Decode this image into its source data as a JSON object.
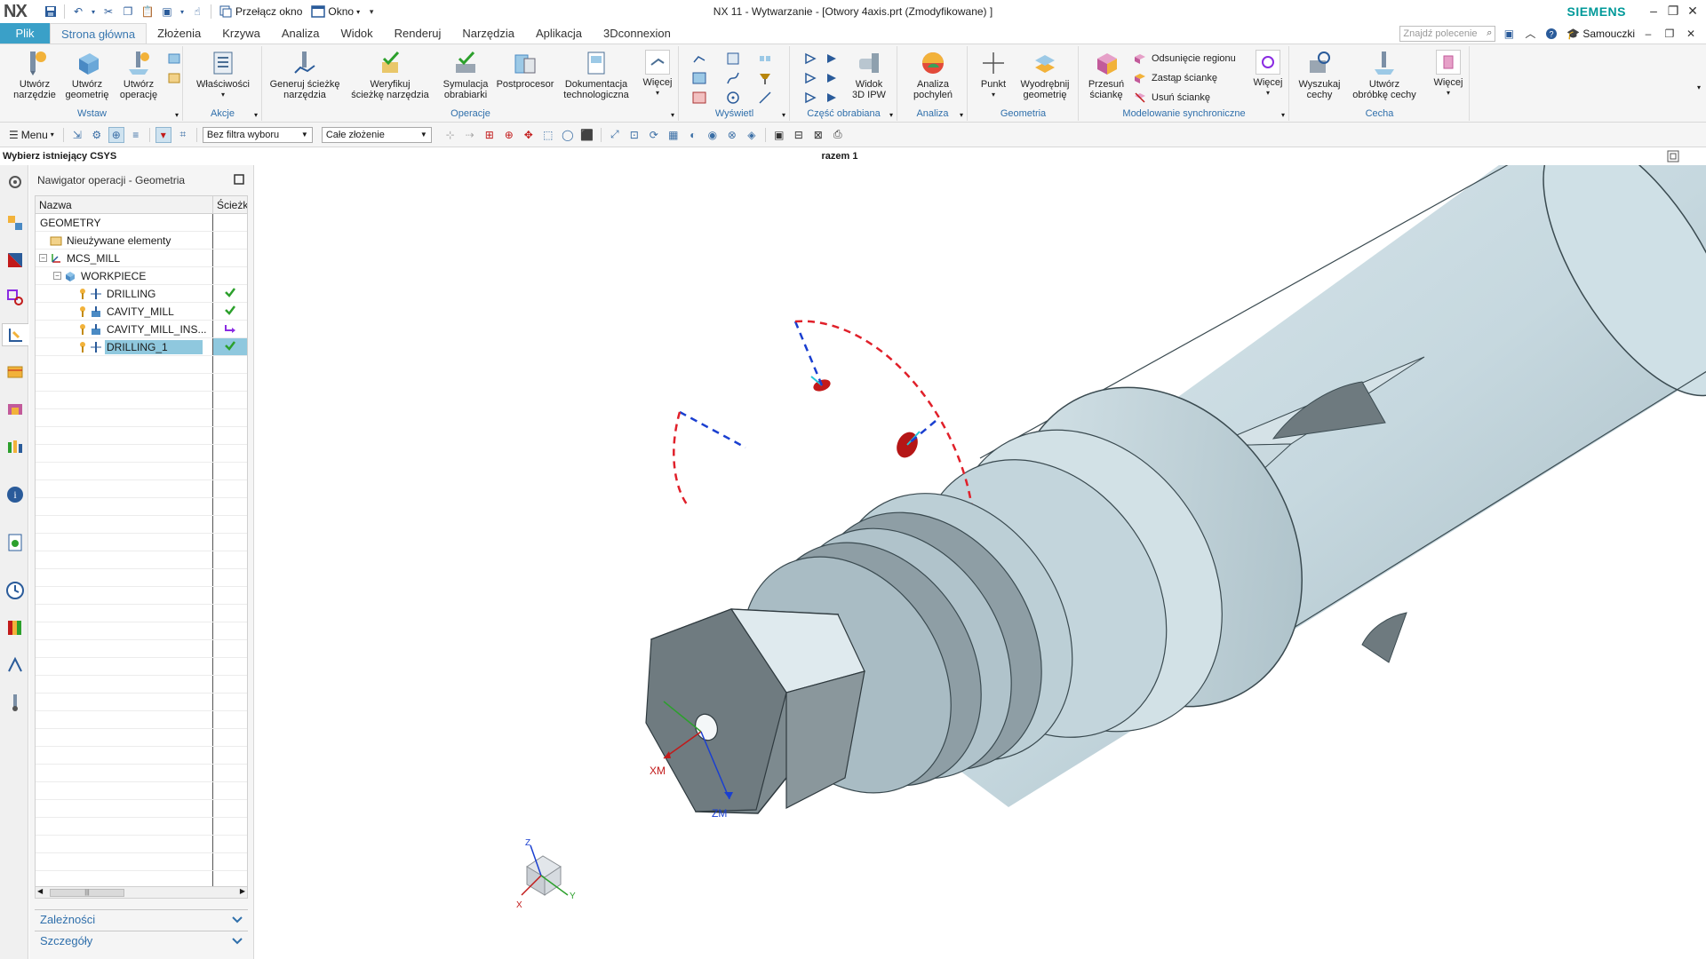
{
  "app": {
    "logo": "NX",
    "window_title": "NX 11 - Wytwarzanie - [Otwory 4axis.prt (Zmodyfikowane) ]",
    "brand": "SIEMENS",
    "switch_window": "Przełącz okno",
    "window_menu": "Okno"
  },
  "tabs": [
    {
      "label": "Plik"
    },
    {
      "label": "Strona główna"
    },
    {
      "label": "Złożenia"
    },
    {
      "label": "Krzywa"
    },
    {
      "label": "Analiza"
    },
    {
      "label": "Widok"
    },
    {
      "label": "Renderuj"
    },
    {
      "label": "Narzędzia"
    },
    {
      "label": "Aplikacja"
    },
    {
      "label": "3Dconnexion"
    }
  ],
  "tabs_right": {
    "search_placeholder": "Znajdź polecenie",
    "tutorials": "Samouczki"
  },
  "ribbon": {
    "wstaw": {
      "label": "Wstaw",
      "b1a": "Utwórz",
      "b1b": "narzędzie",
      "b2a": "Utwórz",
      "b2b": "geometrię",
      "b3a": "Utwórz",
      "b3b": "operację"
    },
    "akcje": {
      "label": "Akcje",
      "b1": "Właściwości"
    },
    "operacje": {
      "label": "Operacje",
      "b1a": "Generuj ścieżkę",
      "b1b": "narzędzia",
      "b2a": "Weryfikuj",
      "b2b": "ścieżkę narzędzia",
      "b3a": "Symulacja",
      "b3b": "obrabiarki",
      "b4": "Postprocesor",
      "b5a": "Dokumentacja",
      "b5b": "technologiczna",
      "b6": "Więcej"
    },
    "wyswietl": {
      "label": "Wyświetl"
    },
    "czesc": {
      "label": "Część obrabiana",
      "b1a": "Widok",
      "b1b": "3D IPW"
    },
    "analiza": {
      "label": "Analiza",
      "b1a": "Analiza",
      "b1b": "pochyleń"
    },
    "geometria": {
      "label": "Geometria",
      "b1": "Punkt",
      "b2a": "Wyodrębnij",
      "b2b": "geometrię"
    },
    "modelowanie": {
      "label": "Modelowanie synchroniczne",
      "b1a": "Przesuń",
      "b1b": "ściankę",
      "s1": "Odsunięcie regionu",
      "s2": "Zastąp ściankę",
      "s3": "Usuń ściankę",
      "b2": "Więcej"
    },
    "cecha": {
      "label": "Cecha",
      "b1a": "Wyszukaj",
      "b1b": "cechy",
      "b2a": "Utwórz",
      "b2b": "obróbkę cechy",
      "b3": "Więcej"
    }
  },
  "cmdbar": {
    "menu": "Menu",
    "filter": "Bez filtra wyboru",
    "scope": "Całe złożenie"
  },
  "cue": {
    "prompt": "Wybierz istniejący CSYS",
    "status": "razem 1"
  },
  "navigator": {
    "title": "Nawigator operacji - Geometria",
    "col_name": "Nazwa",
    "col_path": "Ścieżka",
    "rows": [
      {
        "name": "GEOMETRY",
        "status": ""
      },
      {
        "name": "Nieużywane elementy",
        "status": ""
      },
      {
        "name": "MCS_MILL",
        "status": ""
      },
      {
        "name": "WORKPIECE",
        "status": ""
      },
      {
        "name": "DRILLING",
        "status": "ok"
      },
      {
        "name": "CAVITY_MILL",
        "status": "ok"
      },
      {
        "name": "CAVITY_MILL_INS...",
        "status": "regen"
      },
      {
        "name": "DRILLING_1",
        "status": "ok"
      }
    ],
    "panels": [
      "Zależności",
      "Szczegóły"
    ]
  },
  "viewport": {
    "axis_xm": "XM",
    "axis_zm": "ZM",
    "triad_z": "Z",
    "triad_x": "X",
    "triad_y": "Y"
  },
  "colors": {
    "accent": "#3aa0c8",
    "part_body": "#cde0e6",
    "part_dark": "#6f7b80",
    "hole": "#c21a1a",
    "ok_check": "#2ca02c",
    "regen": "#8a2be2"
  }
}
